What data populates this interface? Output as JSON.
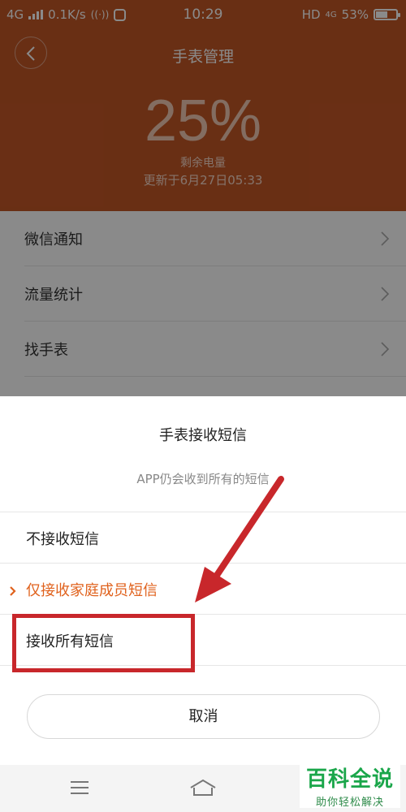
{
  "status_bar": {
    "network": "4G",
    "speed": "0.1K/s",
    "time": "10:29",
    "hd": "HD",
    "hd_net": "4G",
    "battery_text": "53%",
    "battery_level": 0.53
  },
  "header": {
    "title": "手表管理",
    "battery_percent": "25%",
    "battery_label": "剩余电量",
    "updated": "更新于6月27日05:33",
    "background_color": "#c35726"
  },
  "menu": {
    "items": [
      {
        "label": "微信通知"
      },
      {
        "label": "流量统计"
      },
      {
        "label": "找手表"
      }
    ]
  },
  "sheet": {
    "title": "手表接收短信",
    "subtitle": "APP仍会收到所有的短信",
    "options": [
      {
        "label": "不接收短信",
        "selected": false
      },
      {
        "label": "仅接收家庭成员短信",
        "selected": true
      },
      {
        "label": "接收所有短信",
        "selected": false
      }
    ],
    "cancel_label": "取消",
    "accent_color": "#e0621d",
    "annotation_color": "#c8272b"
  },
  "navbar": {
    "icons": [
      "menu-icon",
      "home-icon"
    ]
  },
  "watermark": {
    "main": "百科全说",
    "sub": "助你轻松解决"
  }
}
